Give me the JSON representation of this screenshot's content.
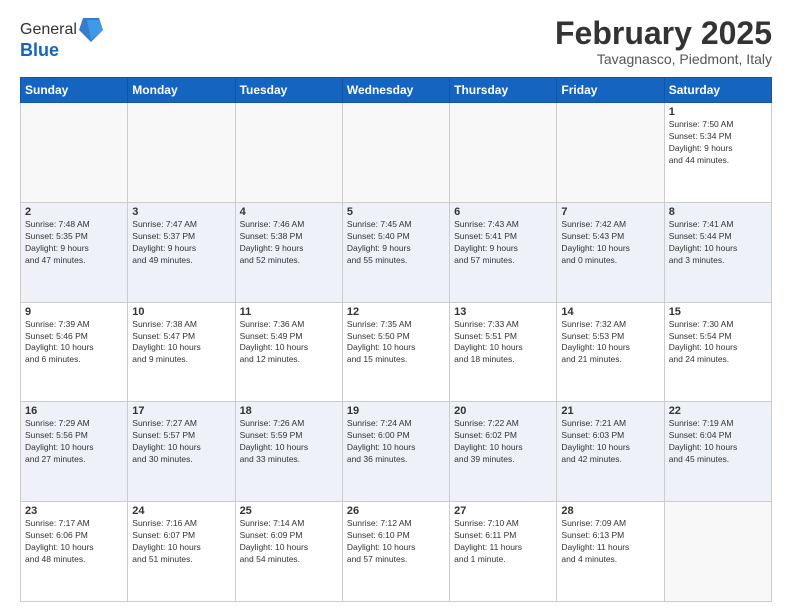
{
  "header": {
    "logo_general": "General",
    "logo_blue": "Blue",
    "month_title": "February 2025",
    "location": "Tavagnasco, Piedmont, Italy"
  },
  "weekdays": [
    "Sunday",
    "Monday",
    "Tuesday",
    "Wednesday",
    "Thursday",
    "Friday",
    "Saturday"
  ],
  "weeks": [
    [
      {
        "day": "",
        "info": ""
      },
      {
        "day": "",
        "info": ""
      },
      {
        "day": "",
        "info": ""
      },
      {
        "day": "",
        "info": ""
      },
      {
        "day": "",
        "info": ""
      },
      {
        "day": "",
        "info": ""
      },
      {
        "day": "1",
        "info": "Sunrise: 7:50 AM\nSunset: 5:34 PM\nDaylight: 9 hours\nand 44 minutes."
      }
    ],
    [
      {
        "day": "2",
        "info": "Sunrise: 7:48 AM\nSunset: 5:35 PM\nDaylight: 9 hours\nand 47 minutes."
      },
      {
        "day": "3",
        "info": "Sunrise: 7:47 AM\nSunset: 5:37 PM\nDaylight: 9 hours\nand 49 minutes."
      },
      {
        "day": "4",
        "info": "Sunrise: 7:46 AM\nSunset: 5:38 PM\nDaylight: 9 hours\nand 52 minutes."
      },
      {
        "day": "5",
        "info": "Sunrise: 7:45 AM\nSunset: 5:40 PM\nDaylight: 9 hours\nand 55 minutes."
      },
      {
        "day": "6",
        "info": "Sunrise: 7:43 AM\nSunset: 5:41 PM\nDaylight: 9 hours\nand 57 minutes."
      },
      {
        "day": "7",
        "info": "Sunrise: 7:42 AM\nSunset: 5:43 PM\nDaylight: 10 hours\nand 0 minutes."
      },
      {
        "day": "8",
        "info": "Sunrise: 7:41 AM\nSunset: 5:44 PM\nDaylight: 10 hours\nand 3 minutes."
      }
    ],
    [
      {
        "day": "9",
        "info": "Sunrise: 7:39 AM\nSunset: 5:46 PM\nDaylight: 10 hours\nand 6 minutes."
      },
      {
        "day": "10",
        "info": "Sunrise: 7:38 AM\nSunset: 5:47 PM\nDaylight: 10 hours\nand 9 minutes."
      },
      {
        "day": "11",
        "info": "Sunrise: 7:36 AM\nSunset: 5:49 PM\nDaylight: 10 hours\nand 12 minutes."
      },
      {
        "day": "12",
        "info": "Sunrise: 7:35 AM\nSunset: 5:50 PM\nDaylight: 10 hours\nand 15 minutes."
      },
      {
        "day": "13",
        "info": "Sunrise: 7:33 AM\nSunset: 5:51 PM\nDaylight: 10 hours\nand 18 minutes."
      },
      {
        "day": "14",
        "info": "Sunrise: 7:32 AM\nSunset: 5:53 PM\nDaylight: 10 hours\nand 21 minutes."
      },
      {
        "day": "15",
        "info": "Sunrise: 7:30 AM\nSunset: 5:54 PM\nDaylight: 10 hours\nand 24 minutes."
      }
    ],
    [
      {
        "day": "16",
        "info": "Sunrise: 7:29 AM\nSunset: 5:56 PM\nDaylight: 10 hours\nand 27 minutes."
      },
      {
        "day": "17",
        "info": "Sunrise: 7:27 AM\nSunset: 5:57 PM\nDaylight: 10 hours\nand 30 minutes."
      },
      {
        "day": "18",
        "info": "Sunrise: 7:26 AM\nSunset: 5:59 PM\nDaylight: 10 hours\nand 33 minutes."
      },
      {
        "day": "19",
        "info": "Sunrise: 7:24 AM\nSunset: 6:00 PM\nDaylight: 10 hours\nand 36 minutes."
      },
      {
        "day": "20",
        "info": "Sunrise: 7:22 AM\nSunset: 6:02 PM\nDaylight: 10 hours\nand 39 minutes."
      },
      {
        "day": "21",
        "info": "Sunrise: 7:21 AM\nSunset: 6:03 PM\nDaylight: 10 hours\nand 42 minutes."
      },
      {
        "day": "22",
        "info": "Sunrise: 7:19 AM\nSunset: 6:04 PM\nDaylight: 10 hours\nand 45 minutes."
      }
    ],
    [
      {
        "day": "23",
        "info": "Sunrise: 7:17 AM\nSunset: 6:06 PM\nDaylight: 10 hours\nand 48 minutes."
      },
      {
        "day": "24",
        "info": "Sunrise: 7:16 AM\nSunset: 6:07 PM\nDaylight: 10 hours\nand 51 minutes."
      },
      {
        "day": "25",
        "info": "Sunrise: 7:14 AM\nSunset: 6:09 PM\nDaylight: 10 hours\nand 54 minutes."
      },
      {
        "day": "26",
        "info": "Sunrise: 7:12 AM\nSunset: 6:10 PM\nDaylight: 10 hours\nand 57 minutes."
      },
      {
        "day": "27",
        "info": "Sunrise: 7:10 AM\nSunset: 6:11 PM\nDaylight: 11 hours\nand 1 minute."
      },
      {
        "day": "28",
        "info": "Sunrise: 7:09 AM\nSunset: 6:13 PM\nDaylight: 11 hours\nand 4 minutes."
      },
      {
        "day": "",
        "info": ""
      }
    ]
  ]
}
